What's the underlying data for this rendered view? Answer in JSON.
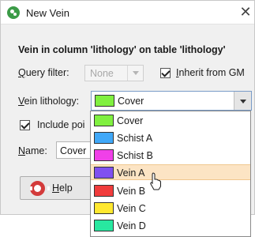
{
  "window": {
    "title": "New Vein",
    "close_symbol": "✕"
  },
  "heading": "Vein in column 'lithology' on table 'lithology'",
  "query_filter": {
    "label": "Query filter:",
    "value": "None",
    "inherit_label": "Inherit from GM",
    "inherit_checked": true
  },
  "vein_lithology": {
    "label": "Vein lithology:",
    "value": "Cover",
    "swatch": "#80f040"
  },
  "include_poi": {
    "label": "Include poi",
    "checked": true
  },
  "name": {
    "label": "Name:",
    "value": "Cover"
  },
  "help_button": {
    "label": "Help"
  },
  "dropdown": {
    "items": [
      {
        "label": "Cover",
        "color": "#80f040"
      },
      {
        "label": "Schist A",
        "color": "#40a8f8"
      },
      {
        "label": "Schist B",
        "color": "#f040e8"
      },
      {
        "label": "Vein A",
        "color": "#8050f0"
      },
      {
        "label": "Vein B",
        "color": "#f03c3c"
      },
      {
        "label": "Vein C",
        "color": "#ffe830"
      },
      {
        "label": "Vein D",
        "color": "#28e8a0"
      }
    ],
    "hovered_label": "Vein A"
  },
  "colors": {
    "accent": "#3b9b47",
    "hover": "#fce4c4"
  }
}
